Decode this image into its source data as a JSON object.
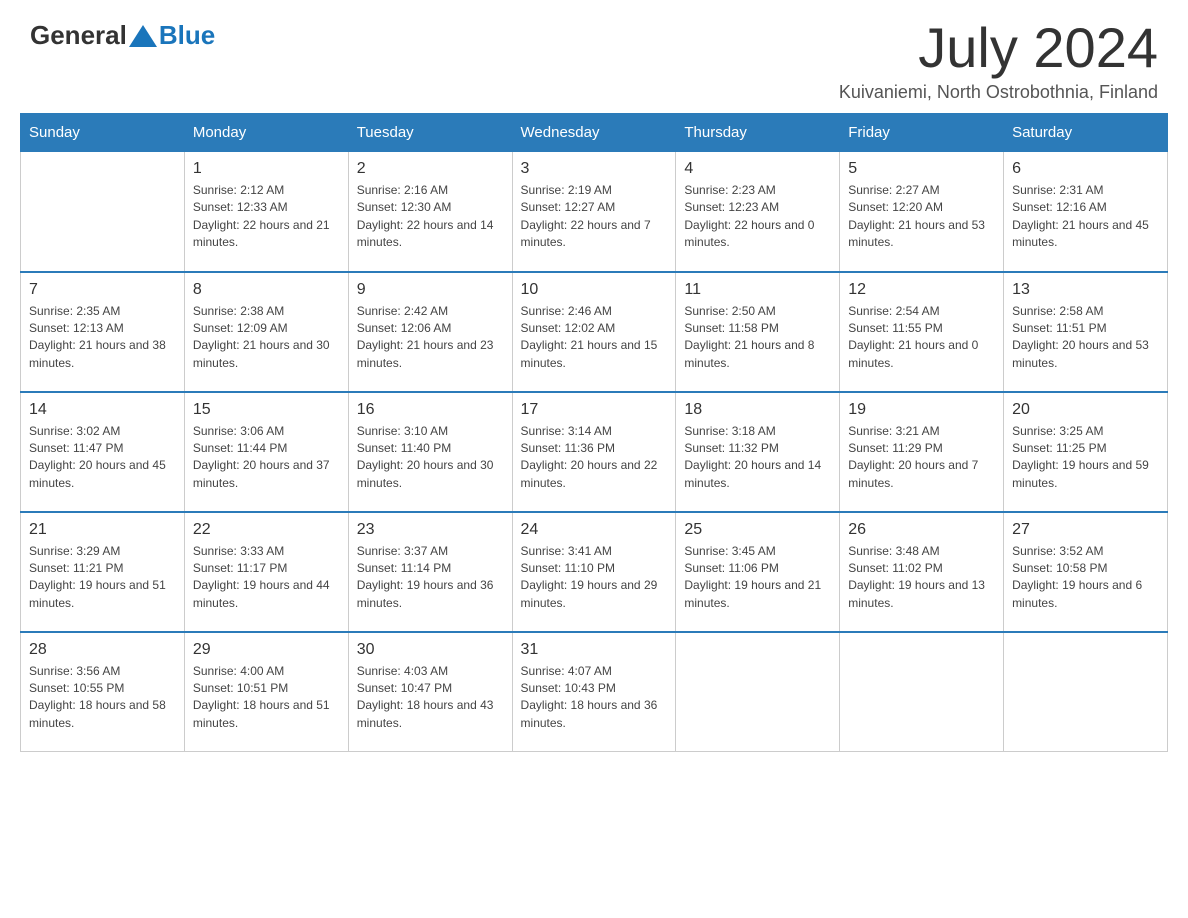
{
  "header": {
    "logo_general": "General",
    "logo_blue": "Blue",
    "month_year": "July 2024",
    "location": "Kuivaniemi, North Ostrobothnia, Finland"
  },
  "days_of_week": [
    "Sunday",
    "Monday",
    "Tuesday",
    "Wednesday",
    "Thursday",
    "Friday",
    "Saturday"
  ],
  "weeks": [
    [
      {
        "day": "",
        "sunrise": "",
        "sunset": "",
        "daylight": ""
      },
      {
        "day": "1",
        "sunrise": "Sunrise: 2:12 AM",
        "sunset": "Sunset: 12:33 AM",
        "daylight": "Daylight: 22 hours and 21 minutes."
      },
      {
        "day": "2",
        "sunrise": "Sunrise: 2:16 AM",
        "sunset": "Sunset: 12:30 AM",
        "daylight": "Daylight: 22 hours and 14 minutes."
      },
      {
        "day": "3",
        "sunrise": "Sunrise: 2:19 AM",
        "sunset": "Sunset: 12:27 AM",
        "daylight": "Daylight: 22 hours and 7 minutes."
      },
      {
        "day": "4",
        "sunrise": "Sunrise: 2:23 AM",
        "sunset": "Sunset: 12:23 AM",
        "daylight": "Daylight: 22 hours and 0 minutes."
      },
      {
        "day": "5",
        "sunrise": "Sunrise: 2:27 AM",
        "sunset": "Sunset: 12:20 AM",
        "daylight": "Daylight: 21 hours and 53 minutes."
      },
      {
        "day": "6",
        "sunrise": "Sunrise: 2:31 AM",
        "sunset": "Sunset: 12:16 AM",
        "daylight": "Daylight: 21 hours and 45 minutes."
      }
    ],
    [
      {
        "day": "7",
        "sunrise": "Sunrise: 2:35 AM",
        "sunset": "Sunset: 12:13 AM",
        "daylight": "Daylight: 21 hours and 38 minutes."
      },
      {
        "day": "8",
        "sunrise": "Sunrise: 2:38 AM",
        "sunset": "Sunset: 12:09 AM",
        "daylight": "Daylight: 21 hours and 30 minutes."
      },
      {
        "day": "9",
        "sunrise": "Sunrise: 2:42 AM",
        "sunset": "Sunset: 12:06 AM",
        "daylight": "Daylight: 21 hours and 23 minutes."
      },
      {
        "day": "10",
        "sunrise": "Sunrise: 2:46 AM",
        "sunset": "Sunset: 12:02 AM",
        "daylight": "Daylight: 21 hours and 15 minutes."
      },
      {
        "day": "11",
        "sunrise": "Sunrise: 2:50 AM",
        "sunset": "Sunset: 11:58 PM",
        "daylight": "Daylight: 21 hours and 8 minutes."
      },
      {
        "day": "12",
        "sunrise": "Sunrise: 2:54 AM",
        "sunset": "Sunset: 11:55 PM",
        "daylight": "Daylight: 21 hours and 0 minutes."
      },
      {
        "day": "13",
        "sunrise": "Sunrise: 2:58 AM",
        "sunset": "Sunset: 11:51 PM",
        "daylight": "Daylight: 20 hours and 53 minutes."
      }
    ],
    [
      {
        "day": "14",
        "sunrise": "Sunrise: 3:02 AM",
        "sunset": "Sunset: 11:47 PM",
        "daylight": "Daylight: 20 hours and 45 minutes."
      },
      {
        "day": "15",
        "sunrise": "Sunrise: 3:06 AM",
        "sunset": "Sunset: 11:44 PM",
        "daylight": "Daylight: 20 hours and 37 minutes."
      },
      {
        "day": "16",
        "sunrise": "Sunrise: 3:10 AM",
        "sunset": "Sunset: 11:40 PM",
        "daylight": "Daylight: 20 hours and 30 minutes."
      },
      {
        "day": "17",
        "sunrise": "Sunrise: 3:14 AM",
        "sunset": "Sunset: 11:36 PM",
        "daylight": "Daylight: 20 hours and 22 minutes."
      },
      {
        "day": "18",
        "sunrise": "Sunrise: 3:18 AM",
        "sunset": "Sunset: 11:32 PM",
        "daylight": "Daylight: 20 hours and 14 minutes."
      },
      {
        "day": "19",
        "sunrise": "Sunrise: 3:21 AM",
        "sunset": "Sunset: 11:29 PM",
        "daylight": "Daylight: 20 hours and 7 minutes."
      },
      {
        "day": "20",
        "sunrise": "Sunrise: 3:25 AM",
        "sunset": "Sunset: 11:25 PM",
        "daylight": "Daylight: 19 hours and 59 minutes."
      }
    ],
    [
      {
        "day": "21",
        "sunrise": "Sunrise: 3:29 AM",
        "sunset": "Sunset: 11:21 PM",
        "daylight": "Daylight: 19 hours and 51 minutes."
      },
      {
        "day": "22",
        "sunrise": "Sunrise: 3:33 AM",
        "sunset": "Sunset: 11:17 PM",
        "daylight": "Daylight: 19 hours and 44 minutes."
      },
      {
        "day": "23",
        "sunrise": "Sunrise: 3:37 AM",
        "sunset": "Sunset: 11:14 PM",
        "daylight": "Daylight: 19 hours and 36 minutes."
      },
      {
        "day": "24",
        "sunrise": "Sunrise: 3:41 AM",
        "sunset": "Sunset: 11:10 PM",
        "daylight": "Daylight: 19 hours and 29 minutes."
      },
      {
        "day": "25",
        "sunrise": "Sunrise: 3:45 AM",
        "sunset": "Sunset: 11:06 PM",
        "daylight": "Daylight: 19 hours and 21 minutes."
      },
      {
        "day": "26",
        "sunrise": "Sunrise: 3:48 AM",
        "sunset": "Sunset: 11:02 PM",
        "daylight": "Daylight: 19 hours and 13 minutes."
      },
      {
        "day": "27",
        "sunrise": "Sunrise: 3:52 AM",
        "sunset": "Sunset: 10:58 PM",
        "daylight": "Daylight: 19 hours and 6 minutes."
      }
    ],
    [
      {
        "day": "28",
        "sunrise": "Sunrise: 3:56 AM",
        "sunset": "Sunset: 10:55 PM",
        "daylight": "Daylight: 18 hours and 58 minutes."
      },
      {
        "day": "29",
        "sunrise": "Sunrise: 4:00 AM",
        "sunset": "Sunset: 10:51 PM",
        "daylight": "Daylight: 18 hours and 51 minutes."
      },
      {
        "day": "30",
        "sunrise": "Sunrise: 4:03 AM",
        "sunset": "Sunset: 10:47 PM",
        "daylight": "Daylight: 18 hours and 43 minutes."
      },
      {
        "day": "31",
        "sunrise": "Sunrise: 4:07 AM",
        "sunset": "Sunset: 10:43 PM",
        "daylight": "Daylight: 18 hours and 36 minutes."
      },
      {
        "day": "",
        "sunrise": "",
        "sunset": "",
        "daylight": ""
      },
      {
        "day": "",
        "sunrise": "",
        "sunset": "",
        "daylight": ""
      },
      {
        "day": "",
        "sunrise": "",
        "sunset": "",
        "daylight": ""
      }
    ]
  ]
}
